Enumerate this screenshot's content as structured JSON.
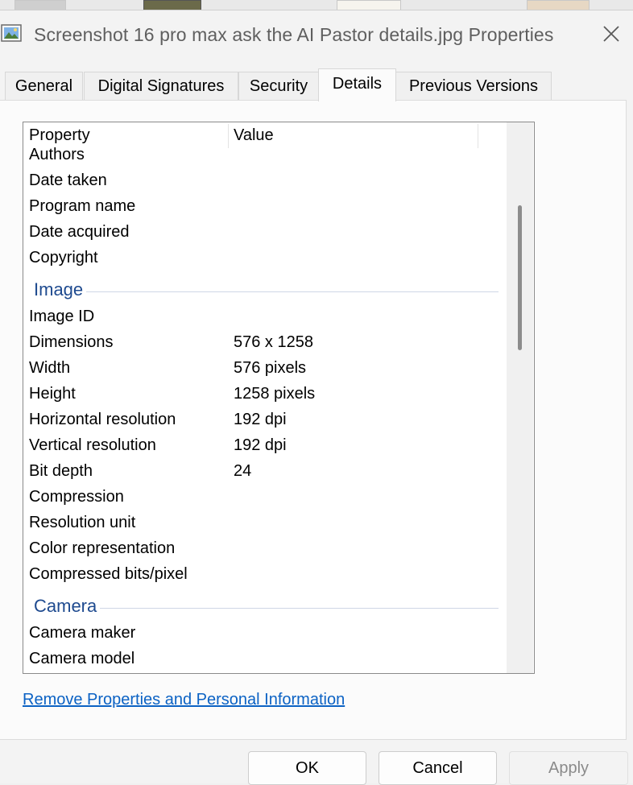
{
  "window": {
    "title": "Screenshot 16 pro max ask the AI Pastor details.jpg Properties"
  },
  "tabs": [
    {
      "label": "General"
    },
    {
      "label": "Digital Signatures"
    },
    {
      "label": "Security"
    },
    {
      "label": "Details"
    },
    {
      "label": "Previous Versions"
    }
  ],
  "active_tab": "Details",
  "list": {
    "header": {
      "property": "Property",
      "value": "Value"
    },
    "rows": [
      {
        "key": "Authors",
        "value": ""
      },
      {
        "key": "Date taken",
        "value": ""
      },
      {
        "key": "Program name",
        "value": ""
      },
      {
        "key": "Date acquired",
        "value": ""
      },
      {
        "key": "Copyright",
        "value": ""
      }
    ],
    "groups": [
      {
        "label": "Image",
        "rows": [
          {
            "key": "Image ID",
            "value": ""
          },
          {
            "key": "Dimensions",
            "value": "576 x 1258"
          },
          {
            "key": "Width",
            "value": "576 pixels"
          },
          {
            "key": "Height",
            "value": "1258 pixels"
          },
          {
            "key": "Horizontal resolution",
            "value": "192 dpi"
          },
          {
            "key": "Vertical resolution",
            "value": "192 dpi"
          },
          {
            "key": "Bit depth",
            "value": "24"
          },
          {
            "key": "Compression",
            "value": ""
          },
          {
            "key": "Resolution unit",
            "value": ""
          },
          {
            "key": "Color representation",
            "value": ""
          },
          {
            "key": "Compressed bits/pixel",
            "value": ""
          }
        ]
      },
      {
        "label": "Camera",
        "rows": [
          {
            "key": "Camera maker",
            "value": ""
          },
          {
            "key": "Camera model",
            "value": ""
          }
        ]
      }
    ]
  },
  "remove_link": "Remove Properties and Personal Information",
  "buttons": {
    "ok": "OK",
    "cancel": "Cancel",
    "apply": "Apply"
  },
  "icons": {
    "app": "image-file-icon",
    "close": "close-icon"
  },
  "colors": {
    "group_label": "#1e4a8f",
    "link": "#0b62c4"
  }
}
